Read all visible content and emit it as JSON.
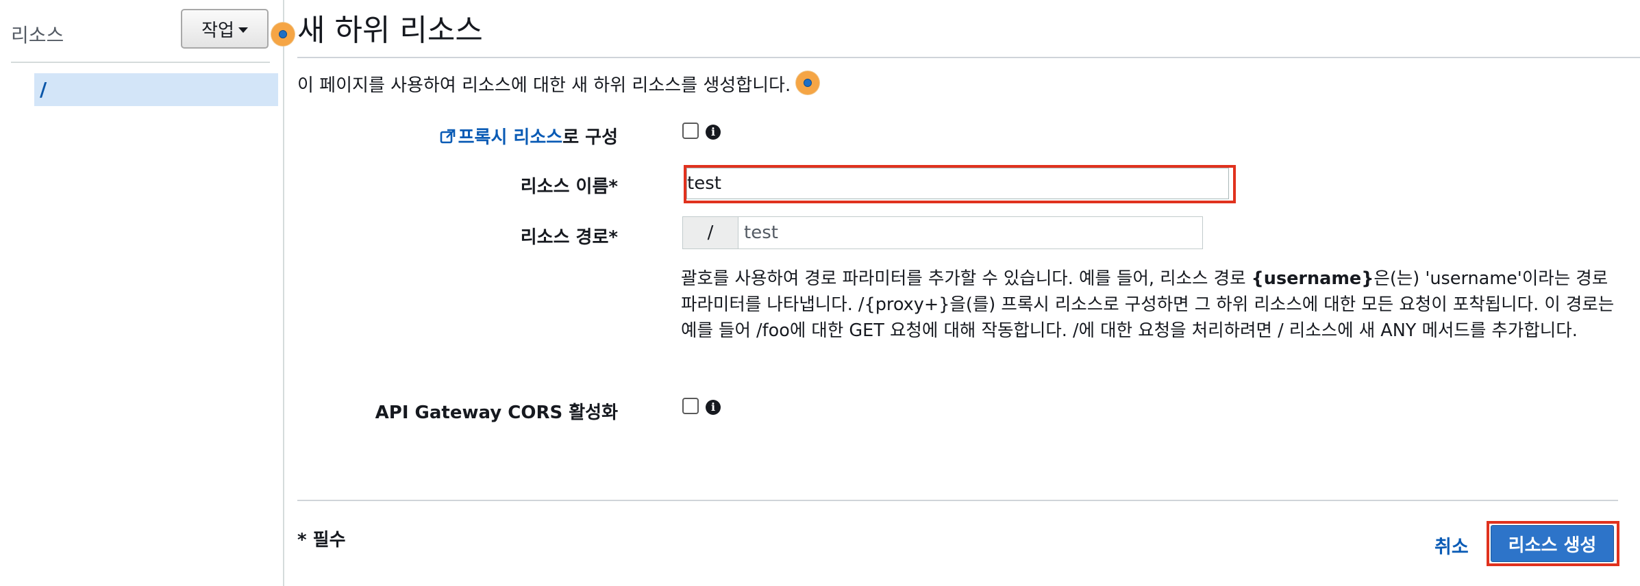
{
  "sidebar": {
    "title": "리소스",
    "action_label": "작업",
    "tree": [
      {
        "label": "/"
      }
    ]
  },
  "main": {
    "title": "새 하위 리소스",
    "description": "이 페이지를 사용하여 리소스에 대한 새 하위 리소스를 생성합니다.",
    "proxy": {
      "link": "프록시 리소스",
      "suffix": "로 구성",
      "checked": false
    },
    "resource_name": {
      "label": "리소스 이름*",
      "value": "test"
    },
    "resource_path": {
      "label": "리소스 경로*",
      "prefix": "/",
      "value": "test"
    },
    "help": {
      "p1": "괄호를 사용하여 경로 파라미터를 추가할 수 있습니다. 예를 들어, 리소스 경로 ",
      "bold": "{username}",
      "p2": "은(는) 'username'이라는 경로 파라미터를 나타냅니다. /{proxy+}을(를) 프록시 리소스로 구성하면 그 하위 리소스에 대한 모든 요청이 포착됩니다. 이 경로는 예를 들어 /foo에 대한 GET 요청에 대해 작동합니다. /에 대한 요청을 처리하려면 / 리소스에 새 ANY 메서드를 추가합니다."
    },
    "cors": {
      "label": "API Gateway CORS 활성화",
      "checked": false
    },
    "required_note": "* 필수",
    "cancel_label": "취소",
    "create_label": "리소스 생성"
  },
  "colors": {
    "link": "#0a5bb5",
    "primary": "#2d74c9",
    "highlight": "#e0321e",
    "tour_marker": "#f5a545",
    "tree_selected": "#d3e5f8"
  }
}
